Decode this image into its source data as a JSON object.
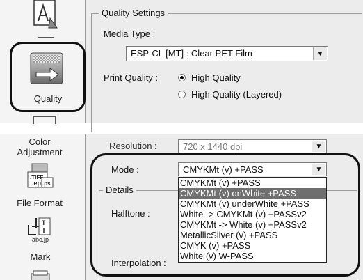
{
  "top": {
    "sidebar": {
      "quality_label": "Quality"
    },
    "quality_settings": {
      "legend": "Quality Settings",
      "media_type_label": "Media Type :",
      "media_type_value": "ESP-CL [MT] : Clear PET Film",
      "print_quality_label": "Print Quality :",
      "options": [
        {
          "label": "High Quality",
          "selected": true
        },
        {
          "label": "High Quality (Layered)",
          "selected": false
        }
      ]
    }
  },
  "bottom": {
    "sidebar": {
      "color_adjustment_label": "Color\nAdjustment",
      "file_format_label": "File Format",
      "mark_label": "Mark"
    },
    "resolution_label": "Resolution :",
    "resolution_value": "720 x 1440 dpi",
    "mode_label": "Mode :",
    "mode_value": "CMYKMt (v) +PASS",
    "details_legend": "Details",
    "halftone_label": "Halftone :",
    "interpolation_label": "Interpolation :",
    "mode_options": [
      {
        "label": "CMYKMt (v) +PASS",
        "selected": false
      },
      {
        "label": "CMYKMt (v) onWhite +PASS",
        "selected": true
      },
      {
        "label": "CMYKMt (v) underWhite +PASS",
        "selected": false
      },
      {
        "label": "White -> CMYKMt (v) +PASSv2",
        "selected": false
      },
      {
        "label": "CMYKMt -> White (v) +PASSv2",
        "selected": false
      },
      {
        "label": "MetallicSilver (v) +PASS",
        "selected": false
      },
      {
        "label": "CMYK (v) +PASS",
        "selected": false
      },
      {
        "label": "White (v) W-PASS",
        "selected": false
      }
    ]
  }
}
